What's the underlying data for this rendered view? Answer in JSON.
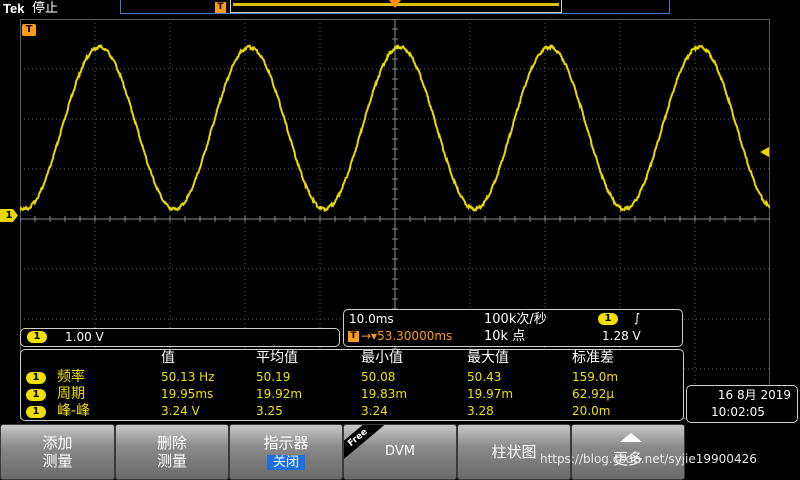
{
  "header": {
    "brand": "Tek",
    "run_state": "停止",
    "trigger_tag": "T"
  },
  "graticule": {
    "h_divisions": 10,
    "v_divisions": 8,
    "grid_color": "#5c5c5c",
    "trace_color": "#e8d800"
  },
  "waveform": {
    "cycles_on_screen": 5,
    "amplitude_divisions": 3.24,
    "offset_divisions": 1.82,
    "phase_start_fraction": 0.72,
    "noise": true
  },
  "markers": {
    "trigger": "T",
    "ch1_ground": "1"
  },
  "channel_scale": {
    "channel": "1",
    "value": "1.00 V"
  },
  "timebase": {
    "scale": "10.0ms",
    "sample_rate": "100k次/秒",
    "trigger_channel": "1",
    "trigger_slope": "∫",
    "trigger_position": "53.30000ms",
    "record_length": "10k 点",
    "trigger_level": "1.28 V"
  },
  "measurements": {
    "headers": [
      "值",
      "平均值",
      "最小值",
      "最大值",
      "标准差"
    ],
    "rows": [
      {
        "channel": "1",
        "name": "频率",
        "values": [
          "50.13 Hz",
          "50.19",
          "50.08",
          "50.43",
          "159.0m"
        ]
      },
      {
        "channel": "1",
        "name": "周期",
        "values": [
          "19.95ms",
          "19.92m",
          "19.83m",
          "19.97m",
          "62.92μ"
        ]
      },
      {
        "channel": "1",
        "name": "峰-峰",
        "values": [
          "3.24 V",
          "3.25",
          "3.24",
          "3.28",
          "20.0m"
        ]
      }
    ]
  },
  "datetime": {
    "date": "16 8月 2019",
    "time": "10:02:05"
  },
  "bezel": {
    "add": [
      "添加",
      "测量"
    ],
    "delete": [
      "删除",
      "测量"
    ],
    "indicator": [
      "指示器",
      "关闭"
    ],
    "dvm_free": "Free",
    "dvm": "DVM",
    "histogram": "柱状图",
    "more": "更多"
  },
  "watermark": "https://blog.csdn.net/syjie19900426"
}
